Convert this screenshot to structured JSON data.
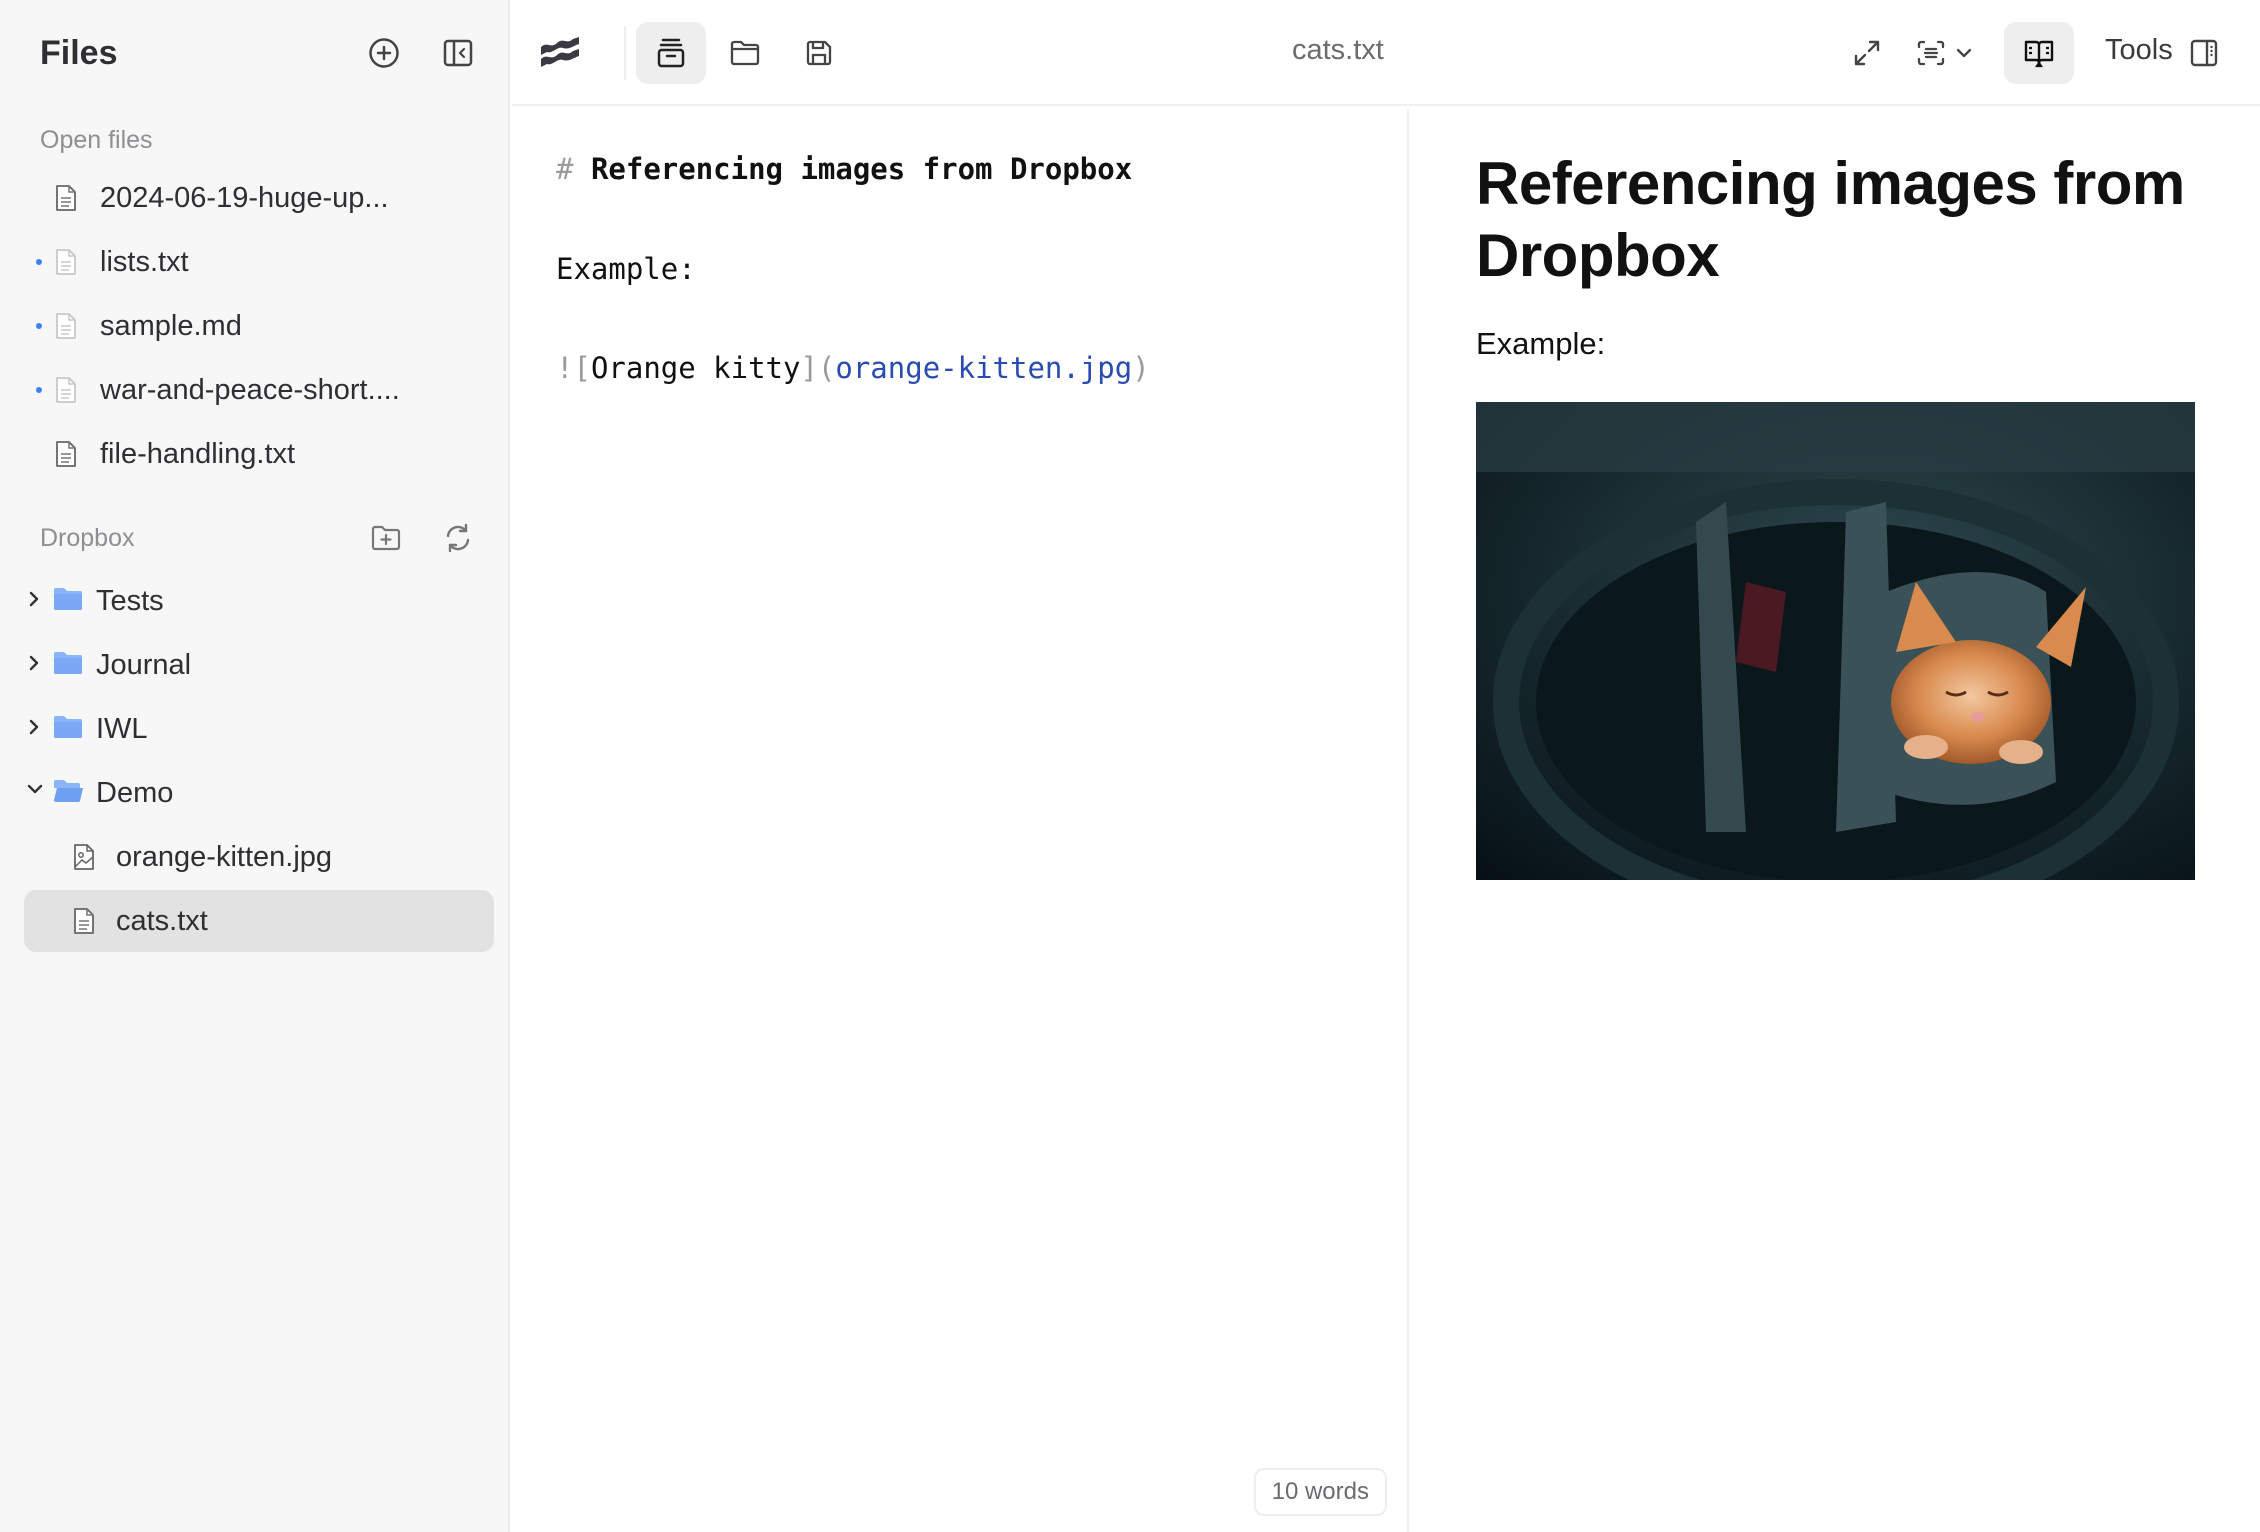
{
  "sidebar": {
    "title": "Files",
    "new_file_icon": "plus-circle-icon",
    "collapse_icon": "sidebar-collapse-icon",
    "open_files_label": "Open files",
    "open_files": [
      {
        "name": "2024-06-19-huge-up...",
        "unsaved": false
      },
      {
        "name": "lists.txt",
        "unsaved": true
      },
      {
        "name": "sample.md",
        "unsaved": true
      },
      {
        "name": "war-and-peace-short....",
        "unsaved": true
      },
      {
        "name": "file-handling.txt",
        "unsaved": false
      }
    ],
    "dropbox_label": "Dropbox",
    "new_folder_icon": "folder-plus-icon",
    "refresh_icon": "refresh-icon",
    "tree": [
      {
        "name": "Tests",
        "type": "folder",
        "expanded": false
      },
      {
        "name": "Journal",
        "type": "folder",
        "expanded": false
      },
      {
        "name": "IWL",
        "type": "folder",
        "expanded": false
      },
      {
        "name": "Demo",
        "type": "folder",
        "expanded": true,
        "children": [
          {
            "name": "orange-kitten.jpg",
            "type": "image"
          },
          {
            "name": "cats.txt",
            "type": "text",
            "selected": true
          }
        ]
      }
    ]
  },
  "toolbar": {
    "logo_icon": "waves-logo-icon",
    "buttons": [
      "archive-icon",
      "folder-open-icon",
      "save-icon"
    ],
    "document_title": "cats.txt",
    "right_buttons": [
      "expand-icon",
      "focus-mode-icon",
      "chevron-down-icon",
      "reader-book-icon"
    ],
    "tools_label": "Tools",
    "right_panel_icon": "right-panel-icon"
  },
  "editor": {
    "heading_mark": "#",
    "heading_text": "Referencing images from Dropbox",
    "paragraph": "Example:",
    "image_md": {
      "bang": "!",
      "open_bracket": "[",
      "alt": "Orange kitty",
      "close_bracket": "]",
      "open_paren": "(",
      "src": "orange-kitten.jpg",
      "close_paren": ")"
    },
    "word_count": "10 words"
  },
  "preview": {
    "heading": "Referencing images from Dropbox",
    "paragraph": "Example:",
    "image_alt": "Orange kitty"
  },
  "colors": {
    "accent_dot": "#3b82f6",
    "link": "#2a4bb0",
    "folder": "#8ab4f8",
    "selected_row": "#e2e2e2"
  }
}
